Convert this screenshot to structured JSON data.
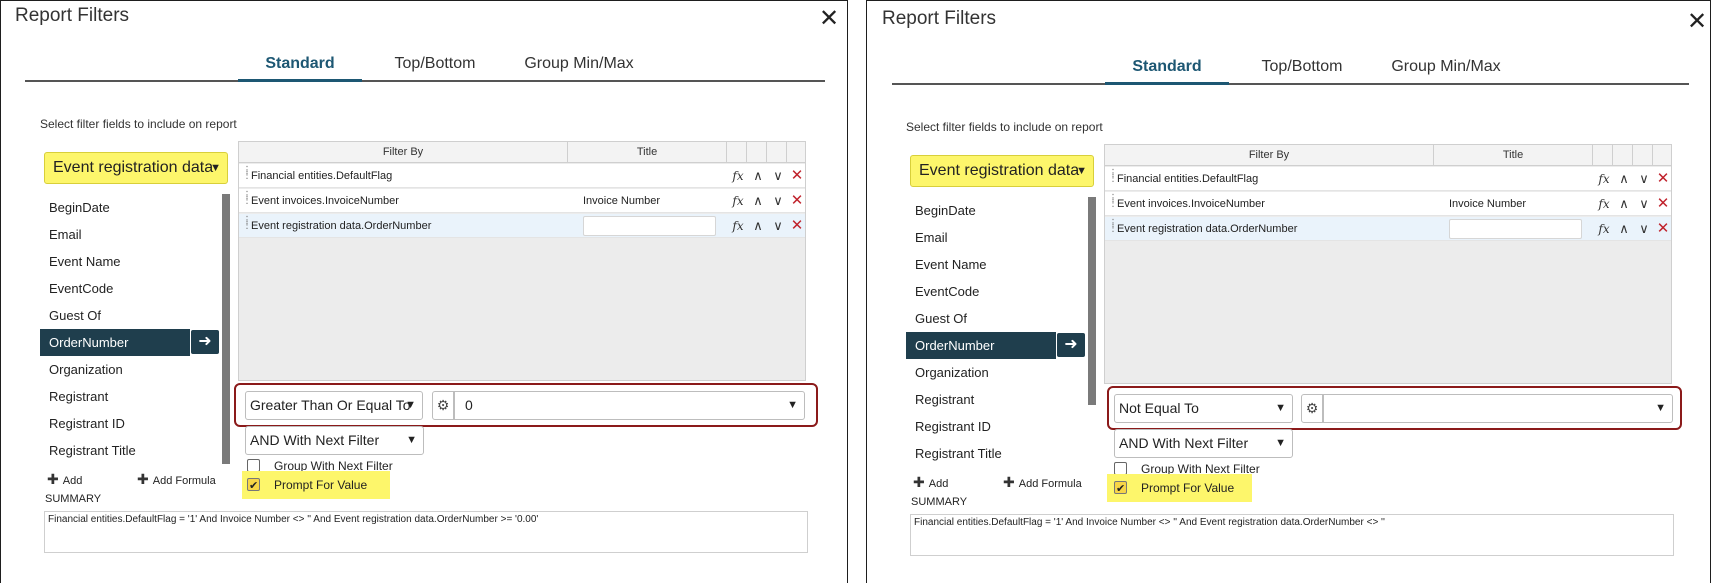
{
  "dialogs": [
    {
      "title": "Report Filters",
      "close_icon": "close-icon",
      "tabs": [
        {
          "label": "Standard",
          "active": true
        },
        {
          "label": "Top/Bottom",
          "active": false
        },
        {
          "label": "Group Min/Max",
          "active": false
        }
      ],
      "instruction": "Select filter fields to include on report",
      "source_select": "Event registration data",
      "fields": [
        "BeginDate",
        "Email",
        "Event Name",
        "EventCode",
        "Guest Of",
        "OrderNumber",
        "Organization",
        "Registrant",
        "Registrant ID",
        "Registrant Title"
      ],
      "selected_field": "OrderNumber",
      "grid": {
        "headers": [
          "Filter By",
          "Title"
        ],
        "rows": [
          {
            "filter": "Financial entities.DefaultFlag",
            "title": ""
          },
          {
            "filter": "Event invoices.InvoiceNumber",
            "title": "Invoice Number"
          },
          {
            "filter": "Event registration data.OrderNumber",
            "title": ""
          }
        ]
      },
      "operator": "Greater Than Or Equal To",
      "value": "0",
      "conjunction": "AND With Next Filter",
      "group_with_next": {
        "label": "Group With Next Filter",
        "checked": false
      },
      "prompt_for_value": {
        "label": "Prompt For Value",
        "checked": true
      },
      "add_label": "Add",
      "add_formula_label": "Add Formula",
      "summary_label": "SUMMARY",
      "summary": "Financial entities.DefaultFlag = '1' And Invoice Number <> '' And Event registration data.OrderNumber >= '0.00'"
    },
    {
      "title": "Report Filters",
      "close_icon": "close-icon",
      "tabs": [
        {
          "label": "Standard",
          "active": true
        },
        {
          "label": "Top/Bottom",
          "active": false
        },
        {
          "label": "Group Min/Max",
          "active": false
        }
      ],
      "instruction": "Select filter fields to include on report",
      "source_select": "Event registration data",
      "fields": [
        "BeginDate",
        "Email",
        "Event Name",
        "EventCode",
        "Guest Of",
        "OrderNumber",
        "Organization",
        "Registrant",
        "Registrant ID",
        "Registrant Title"
      ],
      "selected_field": "OrderNumber",
      "grid": {
        "headers": [
          "Filter By",
          "Title"
        ],
        "rows": [
          {
            "filter": "Financial entities.DefaultFlag",
            "title": ""
          },
          {
            "filter": "Event invoices.InvoiceNumber",
            "title": "Invoice Number"
          },
          {
            "filter": "Event registration data.OrderNumber",
            "title": ""
          }
        ]
      },
      "operator": "Not Equal To",
      "value": "",
      "conjunction": "AND With Next Filter",
      "group_with_next": {
        "label": "Group With Next Filter",
        "checked": false
      },
      "prompt_for_value": {
        "label": "Prompt For Value",
        "checked": true
      },
      "add_label": "Add",
      "add_formula_label": "Add Formula",
      "summary_label": "SUMMARY",
      "summary": "Financial entities.DefaultFlag = '1' And Invoice Number <> '' And Event registration data.OrderNumber <> ''"
    }
  ],
  "colors": {
    "accent": "#1d5773",
    "selected_item": "#1f3e4d",
    "highlight_yellow": "#fdf66b",
    "annotation_red": "#8b1a1a",
    "delete_red": "#c0222c"
  }
}
